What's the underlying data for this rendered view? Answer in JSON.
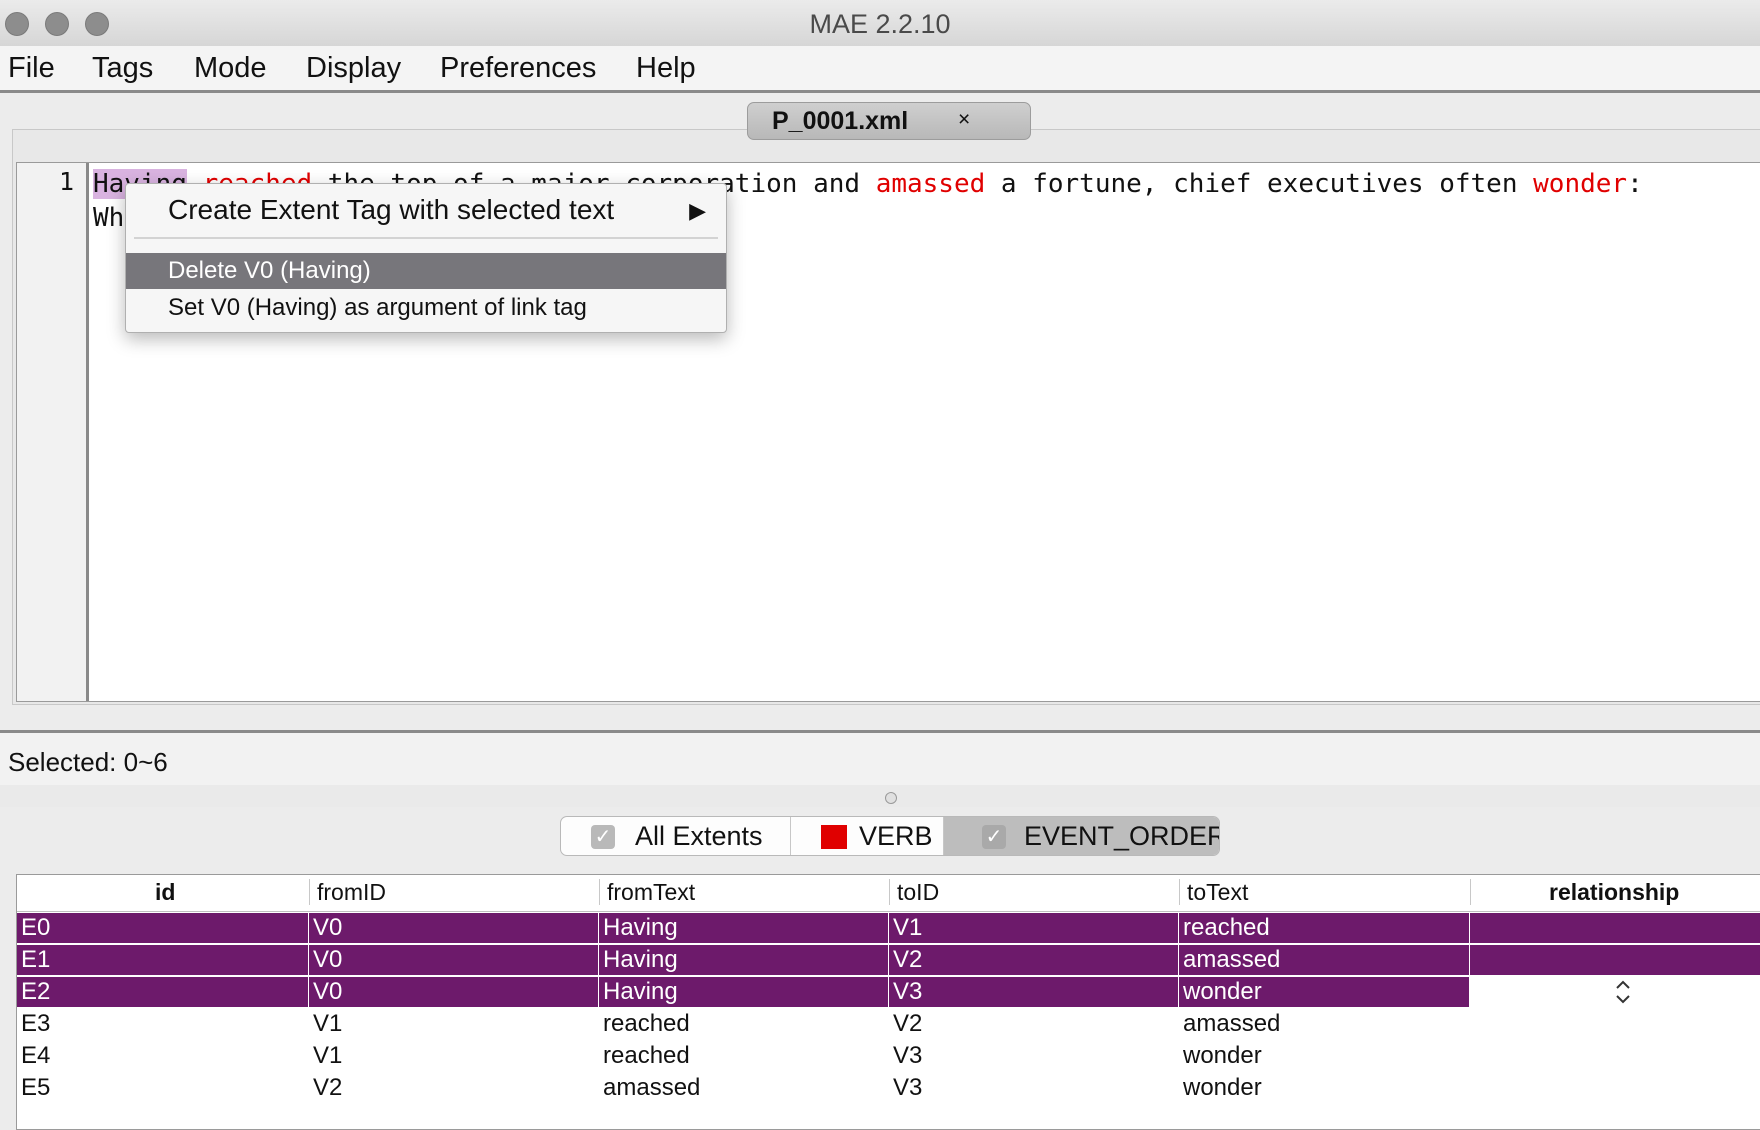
{
  "window": {
    "title": "MAE 2.2.10"
  },
  "menu": [
    "File",
    "Tags",
    "Mode",
    "Display",
    "Preferences",
    "Help"
  ],
  "document_tab": {
    "label": "P_0001.xml",
    "close": "×"
  },
  "editor": {
    "line_number": "1",
    "line1": {
      "w1": "Having",
      "sp1": " ",
      "w2": "reached",
      "t1": " the top of a major corporation and ",
      "w3": "amassed",
      "t2": " a fortune, chief executives often ",
      "w4": "wonder",
      "t3": ":"
    },
    "line2": "Wh"
  },
  "context_menu": {
    "create": "Create Extent Tag with selected text",
    "create_arrow": "▶",
    "delete": "Delete V0 (Having)",
    "set_arg": "Set V0 (Having) as argument of link tag"
  },
  "status": {
    "selected": "Selected: 0~6"
  },
  "tag_tabs": {
    "all_extents": "All Extents",
    "verb": "VERB",
    "event_order": "EVENT_ORDER",
    "check_glyph": "✓",
    "verb_color": "#e00000"
  },
  "table": {
    "columns": [
      "id",
      "fromID",
      "fromText",
      "toID",
      "toText",
      "relationship"
    ],
    "rows": [
      [
        "E0",
        "V0",
        "Having",
        "V1",
        "reached",
        ""
      ],
      [
        "E1",
        "V0",
        "Having",
        "V2",
        "amassed",
        ""
      ],
      [
        "E2",
        "V0",
        "Having",
        "V3",
        "wonder",
        ""
      ],
      [
        "E3",
        "V1",
        "reached",
        "V2",
        "amassed",
        ""
      ],
      [
        "E4",
        "V1",
        "reached",
        "V3",
        "wonder",
        ""
      ],
      [
        "E5",
        "V2",
        "amassed",
        "V3",
        "wonder",
        ""
      ]
    ],
    "selection_color": "#6d1a6b",
    "stepper_glyph": "⌃⌄"
  }
}
